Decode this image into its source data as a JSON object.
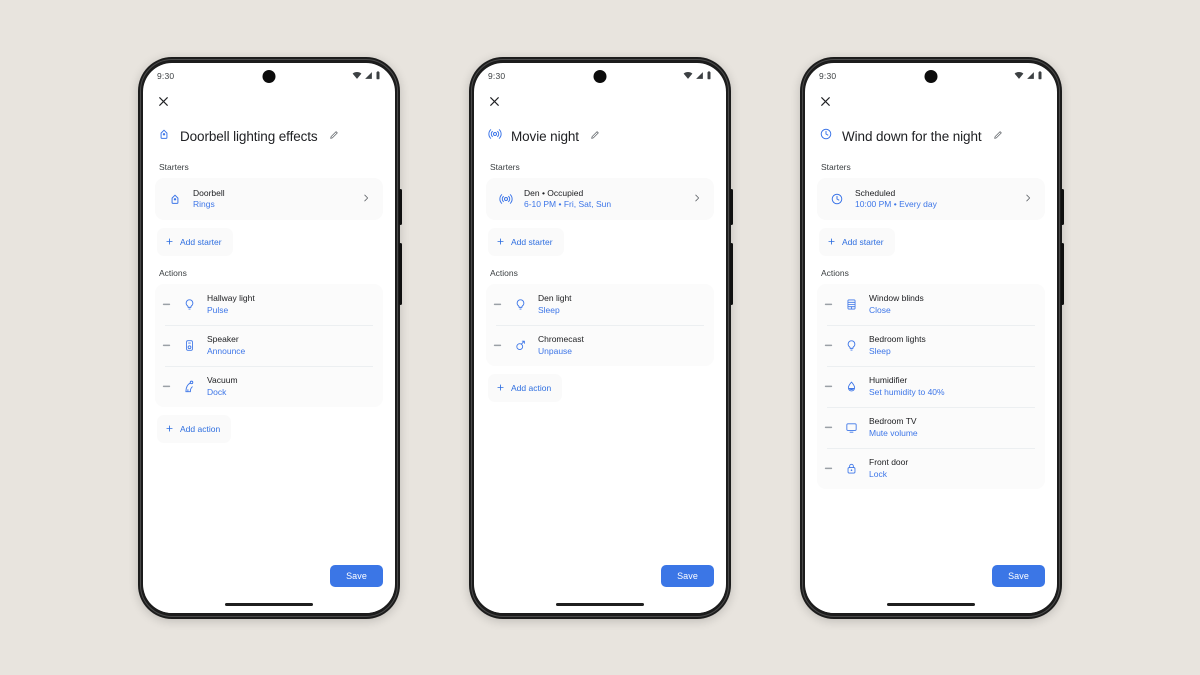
{
  "canvas": {
    "background": "#e8e4de"
  },
  "theme": {
    "accent_blue": "#3d76e8",
    "save_blue": "#3b76e6",
    "text_primary": "#202124",
    "card_bg": "#fbfbfb"
  },
  "phones": [
    {
      "status": {
        "time": "9:30",
        "icons": [
          "wifi-icon",
          "signal-icon",
          "battery-icon"
        ]
      },
      "close_icon": "close-icon",
      "title": "Doorbell lighting effects",
      "title_icon": "doorbell-icon",
      "edit_icon": "pencil-icon",
      "sections": {
        "starters": "Starters",
        "actions": "Actions"
      },
      "starters": [
        {
          "icon": "doorbell-icon",
          "title": "Doorbell",
          "sub": "Rings",
          "chevron": "chevron-right-icon"
        }
      ],
      "add_starter_label": "Add starter",
      "actions": [
        {
          "icon": "light-bulb-icon",
          "title": "Hallway light",
          "sub": "Pulse"
        },
        {
          "icon": "speaker-icon",
          "title": "Speaker",
          "sub": "Announce"
        },
        {
          "icon": "vacuum-icon",
          "title": "Vacuum",
          "sub": "Dock"
        }
      ],
      "add_action_label": "Add action",
      "save_label": "Save"
    },
    {
      "status": {
        "time": "9:30",
        "icons": [
          "wifi-icon",
          "signal-icon",
          "battery-icon"
        ]
      },
      "close_icon": "close-icon",
      "title": "Movie night",
      "title_icon": "presence-sensor-icon",
      "edit_icon": "pencil-icon",
      "sections": {
        "starters": "Starters",
        "actions": "Actions"
      },
      "starters": [
        {
          "icon": "presence-sensor-icon",
          "title": "Den • Occupied",
          "sub": "6-10 PM • Fri, Sat, Sun",
          "chevron": "chevron-right-icon"
        }
      ],
      "add_starter_label": "Add starter",
      "actions": [
        {
          "icon": "light-bulb-icon",
          "title": "Den light",
          "sub": "Sleep"
        },
        {
          "icon": "chromecast-icon",
          "title": "Chromecast",
          "sub": "Unpause"
        }
      ],
      "add_action_label": "Add action",
      "save_label": "Save"
    },
    {
      "status": {
        "time": "9:30",
        "icons": [
          "wifi-icon",
          "signal-icon",
          "battery-icon"
        ]
      },
      "close_icon": "close-icon",
      "title": "Wind down for the night",
      "title_icon": "clock-icon",
      "edit_icon": "pencil-icon",
      "sections": {
        "starters": "Starters",
        "actions": "Actions"
      },
      "starters": [
        {
          "icon": "clock-icon",
          "title": "Scheduled",
          "sub": "10:00 PM • Every day",
          "chevron": "chevron-right-icon"
        }
      ],
      "add_starter_label": "Add starter",
      "actions": [
        {
          "icon": "blinds-icon",
          "title": "Window blinds",
          "sub": "Close"
        },
        {
          "icon": "light-bulb-icon",
          "title": "Bedroom lights",
          "sub": "Sleep"
        },
        {
          "icon": "humidifier-icon",
          "title": "Humidifier",
          "sub": "Set humidity to 40%"
        },
        {
          "icon": "tv-icon",
          "title": "Bedroom TV",
          "sub": "Mute volume"
        },
        {
          "icon": "lock-icon",
          "title": "Front door",
          "sub": "Lock"
        }
      ],
      "add_action_label": "Add action",
      "save_label": "Save"
    }
  ]
}
